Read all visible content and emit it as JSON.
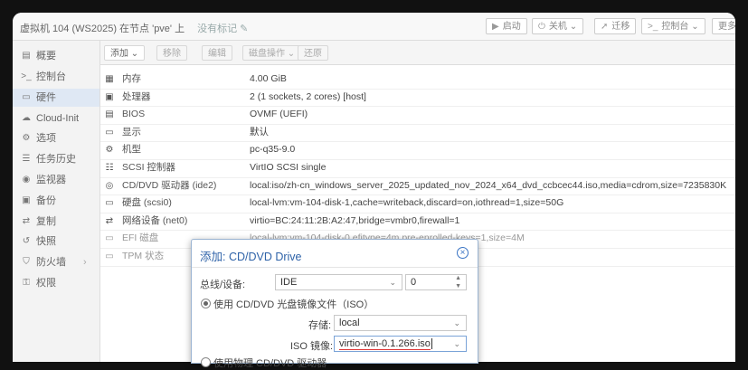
{
  "titlebar": {
    "title": "虚拟机 104 (WS2025) 在节点 'pve' 上",
    "tag_label": "没有标记",
    "buttons": {
      "start": "启动",
      "shutdown": "关机",
      "migrate": "迁移",
      "console": "控制台",
      "more": "更多"
    }
  },
  "sidebar": {
    "items": [
      {
        "icon": "book-icon",
        "glyph": "▤",
        "label": "概要"
      },
      {
        "icon": "terminal-icon",
        "glyph": ">_",
        "label": "控制台"
      },
      {
        "icon": "monitor-icon",
        "glyph": "▭",
        "label": "硬件"
      },
      {
        "icon": "cloud-icon",
        "glyph": "☁",
        "label": "Cloud-Init"
      },
      {
        "icon": "gear-icon",
        "glyph": "⚙",
        "label": "选项"
      },
      {
        "icon": "list-icon",
        "glyph": "☰",
        "label": "任务历史"
      },
      {
        "icon": "eye-icon",
        "glyph": "◉",
        "label": "监视器"
      },
      {
        "icon": "save-icon",
        "glyph": "▣",
        "label": "备份"
      },
      {
        "icon": "retweet-icon",
        "glyph": "⇄",
        "label": "复制"
      },
      {
        "icon": "history-icon",
        "glyph": "↺",
        "label": "快照"
      },
      {
        "icon": "shield-icon",
        "glyph": "⛉",
        "label": "防火墙",
        "chevron": "›"
      },
      {
        "icon": "unlock-icon",
        "glyph": "⚿",
        "label": "权限"
      }
    ]
  },
  "toolbar": {
    "add": "添加",
    "remove": "移除",
    "edit": "编辑",
    "resize": "磁盘操作",
    "revert": "还原"
  },
  "hardware": [
    {
      "icon": "memory-icon",
      "glyph": "▦",
      "key": "内存",
      "value": "4.00 GiB",
      "dim": false
    },
    {
      "icon": "cpu-icon",
      "glyph": "▣",
      "key": "处理器",
      "value": "2 (1 sockets, 2 cores) [host]",
      "dim": false
    },
    {
      "icon": "chip-icon",
      "glyph": "▤",
      "key": "BIOS",
      "value": "OVMF (UEFI)",
      "dim": false
    },
    {
      "icon": "desktop-icon",
      "glyph": "▭",
      "key": "显示",
      "value": "默认",
      "dim": false
    },
    {
      "icon": "cogs-icon",
      "glyph": "⚙",
      "key": "机型",
      "value": "pc-q35-9.0",
      "dim": false
    },
    {
      "icon": "database-icon",
      "glyph": "☷",
      "key": "SCSI 控制器",
      "value": "VirtIO SCSI single",
      "dim": false
    },
    {
      "icon": "cdrom-icon",
      "glyph": "◎",
      "key": "CD/DVD 驱动器 (ide2)",
      "value": "local:iso/zh-cn_windows_server_2025_updated_nov_2024_x64_dvd_ccbcec44.iso,media=cdrom,size=7235830K",
      "dim": false
    },
    {
      "icon": "hdd-icon",
      "glyph": "▭",
      "key": "硬盘 (scsi0)",
      "value": "local-lvm:vm-104-disk-1,cache=writeback,discard=on,iothread=1,size=50G",
      "dim": false
    },
    {
      "icon": "network-icon",
      "glyph": "⇄",
      "key": "网络设备 (net0)",
      "value": "virtio=BC:24:11:2B:A2:47,bridge=vmbr0,firewall=1",
      "dim": false
    },
    {
      "icon": "hdd-icon",
      "glyph": "▭",
      "key": "EFI 磁盘",
      "value": "local-lvm:vm-104-disk-0,efitype=4m,pre-enrolled-keys=1,size=4M",
      "dim": true
    },
    {
      "icon": "hdd-icon",
      "glyph": "▭",
      "key": "TPM 状态",
      "value": "",
      "dim": true
    }
  ],
  "dialog": {
    "title": "添加: CD/DVD Drive",
    "bus_label": "总线/设备:",
    "bus_value": "IDE",
    "device_value": "0",
    "radio_iso_label": "使用 CD/DVD 光盘镜像文件（ISO）",
    "storage_label": "存储:",
    "storage_value": "local",
    "iso_label": "ISO 镜像:",
    "iso_value": "virtio-win-0.1.266.iso",
    "radio_physical_label": "使用物理 CD/DVD 驱动器"
  }
}
